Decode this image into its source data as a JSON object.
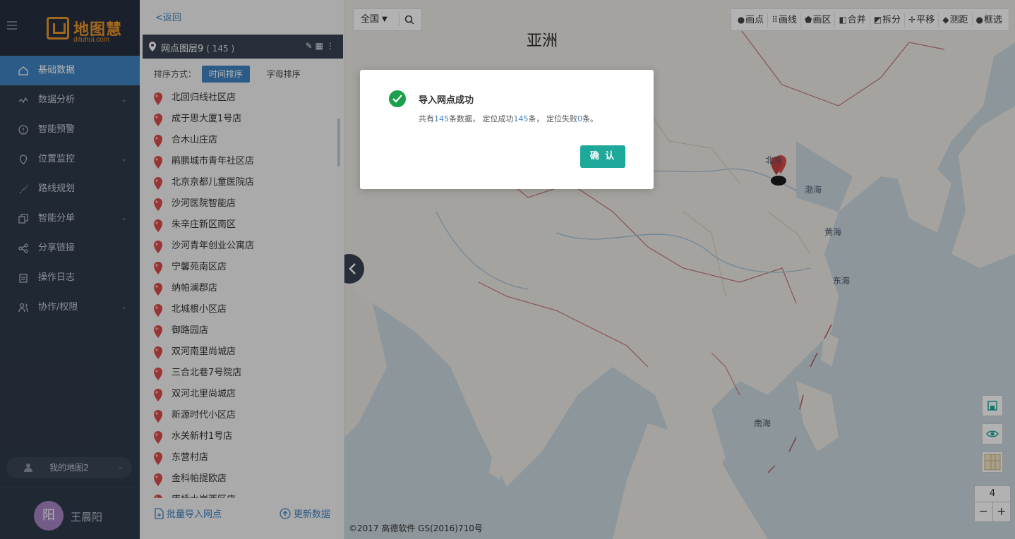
{
  "nav": {
    "brand_text": "地图慧",
    "brand_sub": "dituhui.com",
    "items": [
      {
        "label": "基础数据",
        "active": true
      },
      {
        "label": "数据分析",
        "caret": true
      },
      {
        "label": "智能预警"
      },
      {
        "label": "位置监控",
        "caret": true
      },
      {
        "label": "路线规划"
      },
      {
        "label": "智能分单",
        "caret": true
      },
      {
        "label": "分享链接"
      },
      {
        "label": "操作日志"
      },
      {
        "label": "协作/权限",
        "caret": true
      }
    ],
    "map_switch": "我的地图2",
    "user_initial": "阳",
    "user_name": "王晨阳"
  },
  "panel": {
    "back": "<返回",
    "layer_name": "网点图层9",
    "layer_count": "( 145 )",
    "sort_label": "排序方式：",
    "sort_time": "时间排序",
    "sort_alpha": "字母排序",
    "stores": [
      "北回归线社区店",
      "成于思大厦1号店",
      "合木山庄店",
      "鹃鹏城市青年社区店",
      "北京京都儿童医院店",
      "沙河医院智能店",
      "朱辛庄新区南区",
      "沙河青年创业公寓店",
      "宁馨苑南区店",
      "纳帕澜郡店",
      "北城根小区店",
      "御路园店",
      "双河南里尚城店",
      "三合北巷7号院店",
      "双河北里尚城店",
      "新源时代小区店",
      "水关新村1号店",
      "东营村店",
      "金科帕提欧店",
      "康桥水岸西区店"
    ],
    "batch_import": "批量导入网点",
    "update_data": "更新数据"
  },
  "map": {
    "region": "全国",
    "continent_label": "亚洲",
    "sea_labels": {
      "bohai": "渤海",
      "yellow": "黄海",
      "east": "东海",
      "south": "南海"
    },
    "beijing_label": "北京",
    "tools": [
      {
        "glyph": "●",
        "label": "画点"
      },
      {
        "glyph": "⠿",
        "label": "画线"
      },
      {
        "glyph": "⬟",
        "label": "画区"
      },
      {
        "glyph": "◧",
        "label": "合并"
      },
      {
        "glyph": "◩",
        "label": "拆分"
      },
      {
        "glyph": "✛",
        "label": "平移"
      },
      {
        "glyph": "◆",
        "label": "测距"
      },
      {
        "glyph": "●",
        "label": "框选"
      }
    ],
    "zoom_level": "4",
    "zoom_minus": "−",
    "zoom_plus": "+",
    "copyright": "©2017 高德软件 GS(2016)710号"
  },
  "modal": {
    "title": "导入网点成功",
    "msg_prefix": "共有",
    "total": "145",
    "msg_mid1": "条数据， 定位成功",
    "success": "145",
    "msg_mid2": "条， 定位失败",
    "failed": "0",
    "msg_suffix": "条。",
    "confirm": "确 认"
  },
  "colors": {
    "nav_bg": "#2f3a49",
    "accent": "#3f83c2",
    "confirm_btn": "#1ea89a",
    "success_icon": "#1aa04a",
    "brand": "#e8962c",
    "marker": "#d94c4c"
  }
}
